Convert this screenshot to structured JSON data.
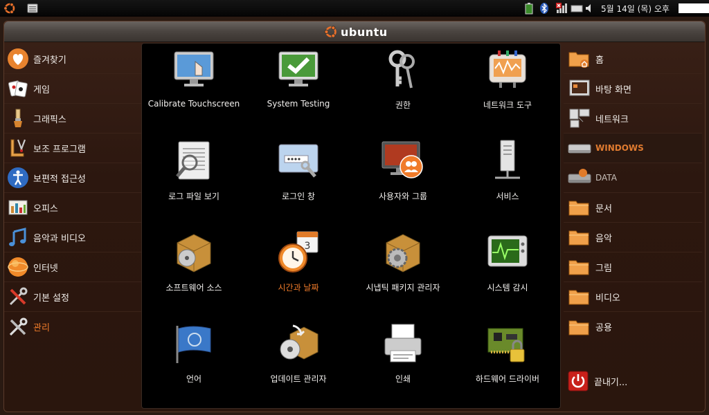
{
  "top_panel": {
    "clock": "5월 14일 (목) 오후"
  },
  "window": {
    "brand": "ubuntu"
  },
  "categories": [
    {
      "label": "즐겨찾기",
      "icon": "heart-icon"
    },
    {
      "label": "게임",
      "icon": "cards-icon"
    },
    {
      "label": "그래픽스",
      "icon": "brush-icon"
    },
    {
      "label": "보조 프로그램",
      "icon": "tools-icon"
    },
    {
      "label": "보편적 접근성",
      "icon": "accessibility-icon"
    },
    {
      "label": "오피스",
      "icon": "office-icon"
    },
    {
      "label": "음악과 비디오",
      "icon": "music-icon"
    },
    {
      "label": "인터넷",
      "icon": "globe-icon"
    },
    {
      "label": "기본 설정",
      "icon": "preferences-icon"
    },
    {
      "label": "관리",
      "icon": "admin-icon",
      "active": true
    }
  ],
  "apps": [
    {
      "label": "Calibrate Touchscreen",
      "icon": "touchscreen-icon"
    },
    {
      "label": "System Testing",
      "icon": "checkmark-monitor-icon"
    },
    {
      "label": "권한",
      "icon": "keys-icon"
    },
    {
      "label": "네트워크 도구",
      "icon": "network-tools-icon"
    },
    {
      "label": "로그 파일 보기",
      "icon": "log-viewer-icon"
    },
    {
      "label": "로그인 창",
      "icon": "login-window-icon"
    },
    {
      "label": "사용자와 그룹",
      "icon": "users-groups-icon"
    },
    {
      "label": "서비스",
      "icon": "services-icon"
    },
    {
      "label": "소프트웨어 소스",
      "icon": "software-sources-icon"
    },
    {
      "label": "시간과 날짜",
      "icon": "clock-calendar-icon",
      "highlight": true
    },
    {
      "label": "시냅틱 패키지 관리자",
      "icon": "synaptic-icon"
    },
    {
      "label": "시스템 감시",
      "icon": "system-monitor-icon"
    },
    {
      "label": "언어",
      "icon": "language-flag-icon"
    },
    {
      "label": "업데이트 관리자",
      "icon": "update-manager-icon"
    },
    {
      "label": "인쇄",
      "icon": "printer-icon"
    },
    {
      "label": "하드웨어 드라이버",
      "icon": "hardware-drivers-icon"
    }
  ],
  "places": [
    {
      "label": "홈",
      "icon": "home-folder-icon"
    },
    {
      "label": "바탕 화면",
      "icon": "desktop-icon"
    },
    {
      "label": "네트워크",
      "icon": "network-icon"
    },
    {
      "label": "WINDOWS",
      "icon": "drive-icon",
      "selected": true
    },
    {
      "label": "DATA",
      "icon": "drive-icon",
      "dim": true
    },
    {
      "label": "문서",
      "icon": "folder-icon"
    },
    {
      "label": "음악",
      "icon": "folder-icon"
    },
    {
      "label": "그림",
      "icon": "folder-icon"
    },
    {
      "label": "비디오",
      "icon": "folder-icon"
    },
    {
      "label": "공용",
      "icon": "folder-icon"
    }
  ],
  "quit": {
    "label": "끝내기...",
    "icon": "power-icon"
  },
  "colors": {
    "accent": "#f07b2a",
    "panel": "#000000",
    "background": "#2c170f"
  }
}
